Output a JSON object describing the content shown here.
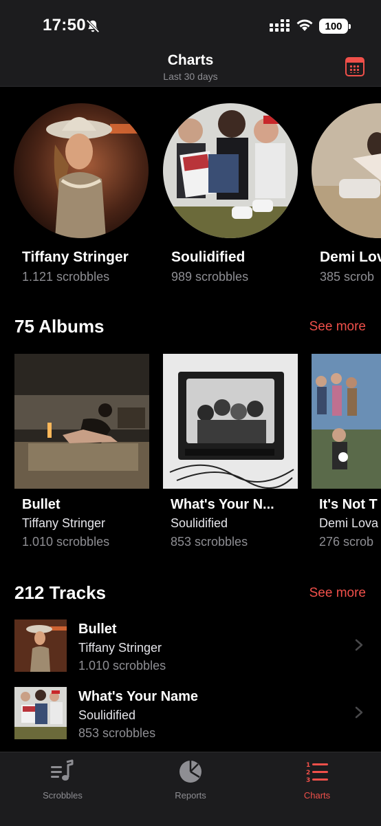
{
  "status": {
    "time": "17:50",
    "battery": "100",
    "icons": [
      "bell-slash-icon",
      "cellular-signal-icon",
      "wifi-icon",
      "battery-icon"
    ]
  },
  "header": {
    "title": "Charts",
    "subtitle": "Last 30 days",
    "calendar_icon": "calendar-icon"
  },
  "artists": [
    {
      "name": "Tiffany Stringer",
      "scrobbles": "1.121 scrobbles"
    },
    {
      "name": "Soulidified",
      "scrobbles": "989 scrobbles"
    },
    {
      "name": "Demi Lov",
      "scrobbles": "385 scrob"
    }
  ],
  "albums_section": {
    "title": "75 Albums",
    "see_more": "See more",
    "items": [
      {
        "title": "Bullet",
        "artist": "Tiffany Stringer",
        "scrobbles": "1.010 scrobbles"
      },
      {
        "title": "What's Your N...",
        "artist": "Soulidified",
        "scrobbles": "853 scrobbles"
      },
      {
        "title": "It's Not T",
        "artist": "Demi Lova",
        "scrobbles": "276 scrob"
      }
    ]
  },
  "tracks_section": {
    "title": "212 Tracks",
    "see_more": "See more",
    "items": [
      {
        "title": "Bullet",
        "artist": "Tiffany Stringer",
        "scrobbles": "1.010 scrobbles"
      },
      {
        "title": "What's Your Name",
        "artist": "Soulidified",
        "scrobbles": "853 scrobbles"
      }
    ]
  },
  "tabbar": {
    "tabs": [
      {
        "label": "Scrobbles",
        "icon": "music-list-icon"
      },
      {
        "label": "Reports",
        "icon": "pie-chart-icon"
      },
      {
        "label": "Charts",
        "icon": "numbered-list-icon"
      }
    ],
    "active": "Charts"
  },
  "colors": {
    "accent": "#f0504a",
    "background": "#000000",
    "bar_background": "#1c1c1e",
    "secondary_text": "#8e8e93"
  }
}
